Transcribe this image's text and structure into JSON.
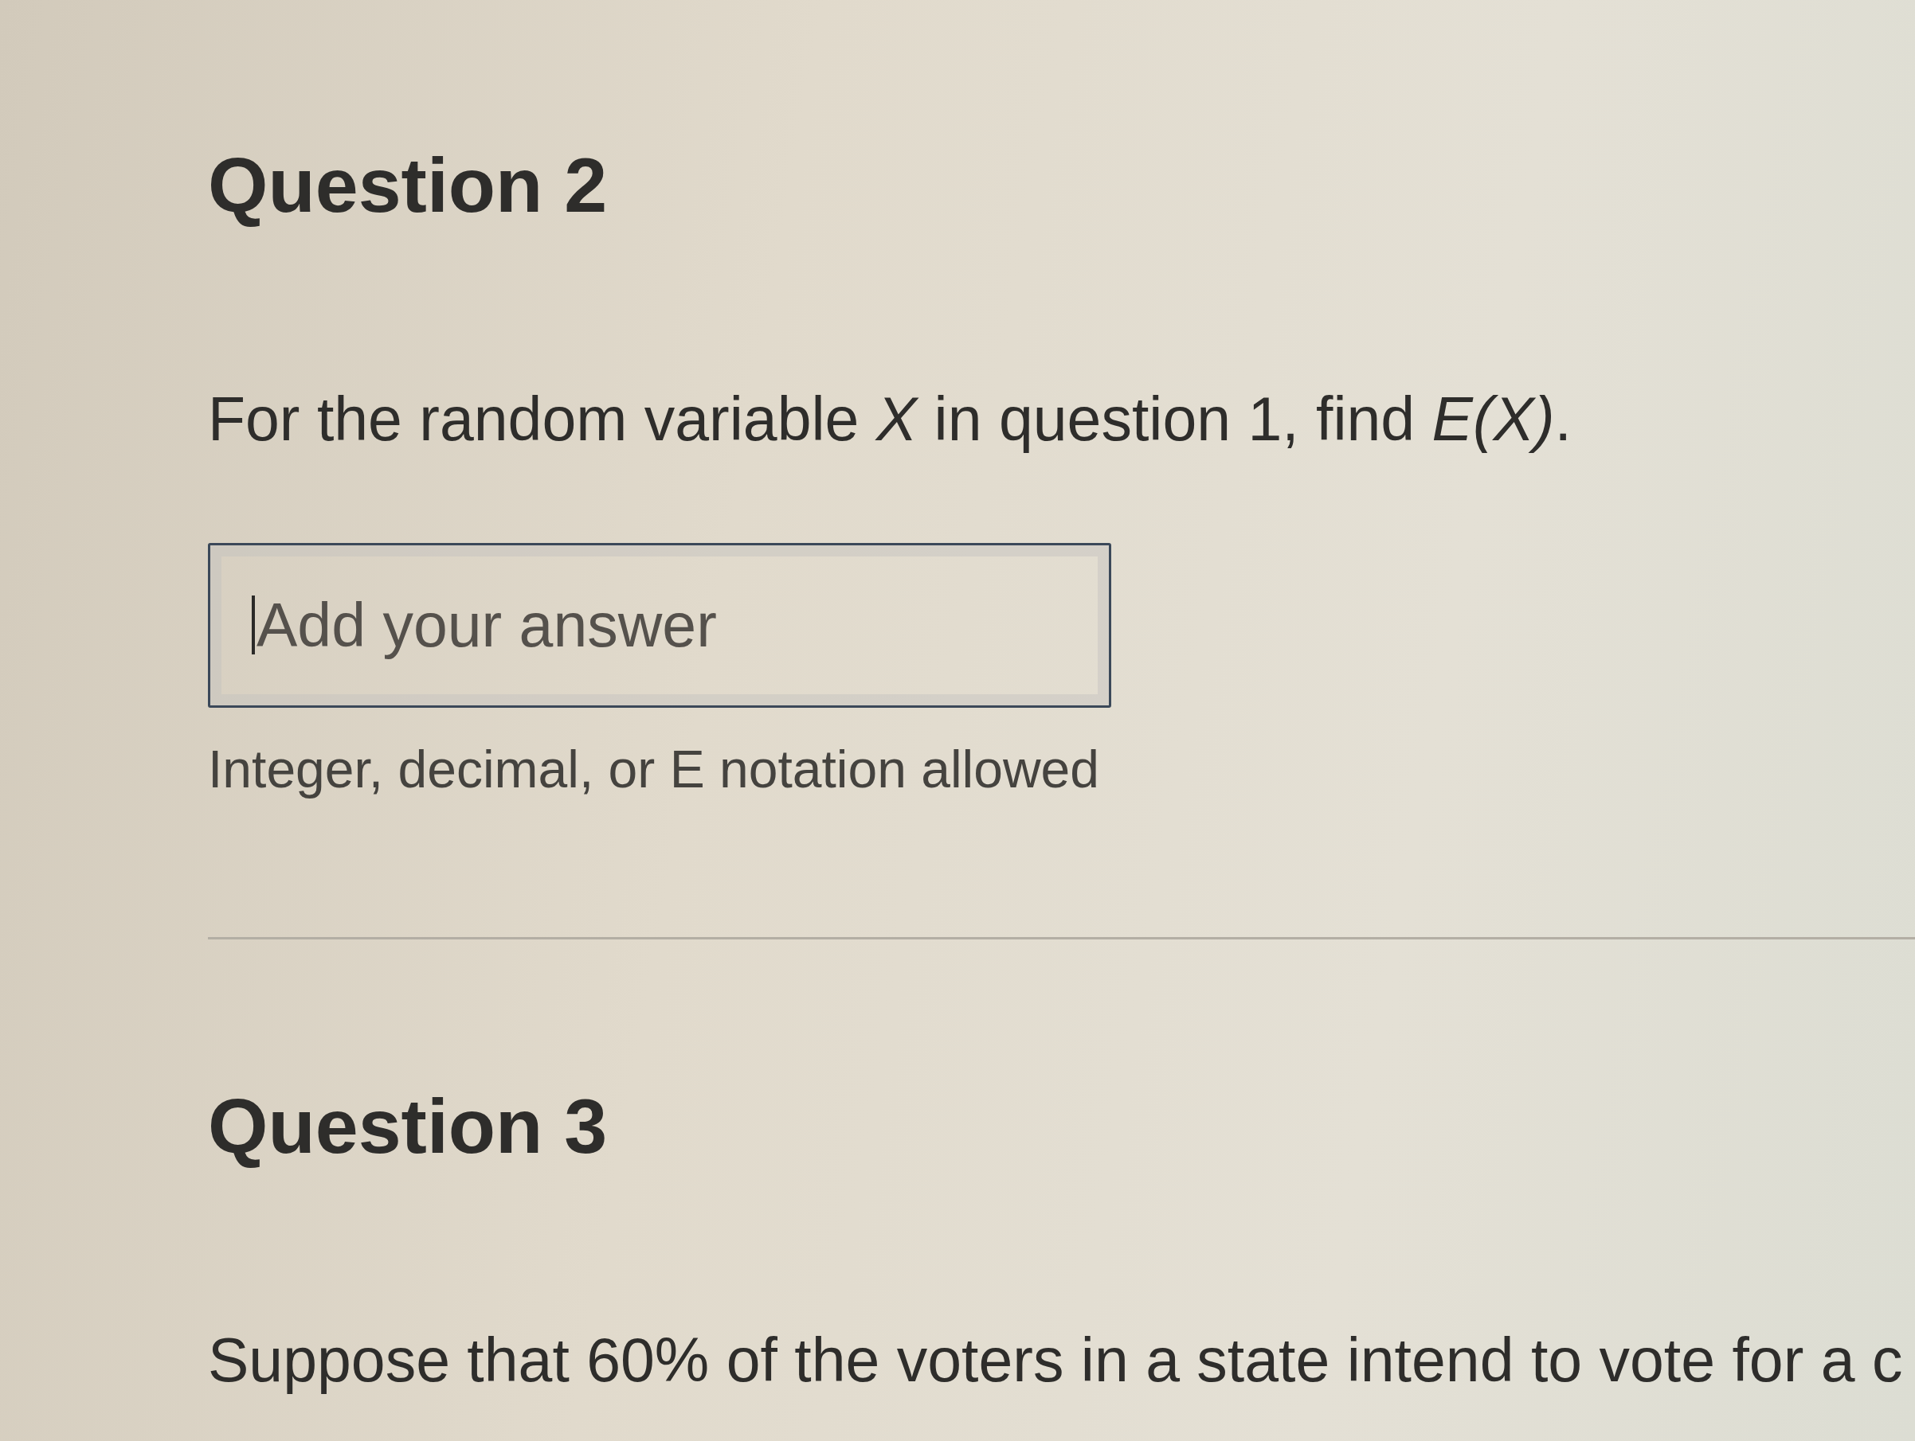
{
  "questions": [
    {
      "heading": "Question 2",
      "prompt": "For the random variable *X* in question 1, find *E(X)*.",
      "answer": {
        "placeholder": "Add your answer",
        "focused": true
      },
      "hint": "Integer, decimal, or E notation allowed"
    },
    {
      "heading": "Question 3",
      "prompt": "Suppose that 60% of the voters in a state intend to vote for a c"
    }
  ]
}
